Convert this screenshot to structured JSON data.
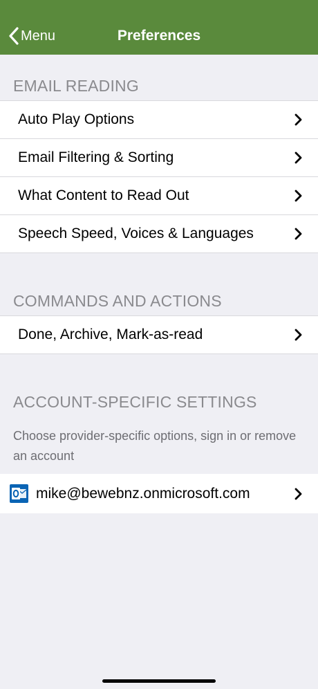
{
  "navbar": {
    "back_label": "Menu",
    "title": "Preferences"
  },
  "sections": {
    "email_reading": {
      "header": "EMAIL READING",
      "items": [
        "Auto Play Options",
        "Email Filtering & Sorting",
        "What Content to Read Out",
        "Speech Speed, Voices & Languages"
      ]
    },
    "commands": {
      "header": "COMMANDS AND ACTIONS",
      "items": [
        "Done, Archive, Mark-as-read"
      ]
    },
    "account": {
      "header": "ACCOUNT-SPECIFIC SETTINGS",
      "description": "Choose provider-specific options, sign in or remove an account",
      "accounts": [
        {
          "email": "mike@bewebnz.onmicrosoft.com",
          "icon": "outlook-icon"
        }
      ]
    }
  },
  "colors": {
    "navbar": "#5a8a3c",
    "background": "#efeff4",
    "outlook_blue": "#0a64b4"
  }
}
